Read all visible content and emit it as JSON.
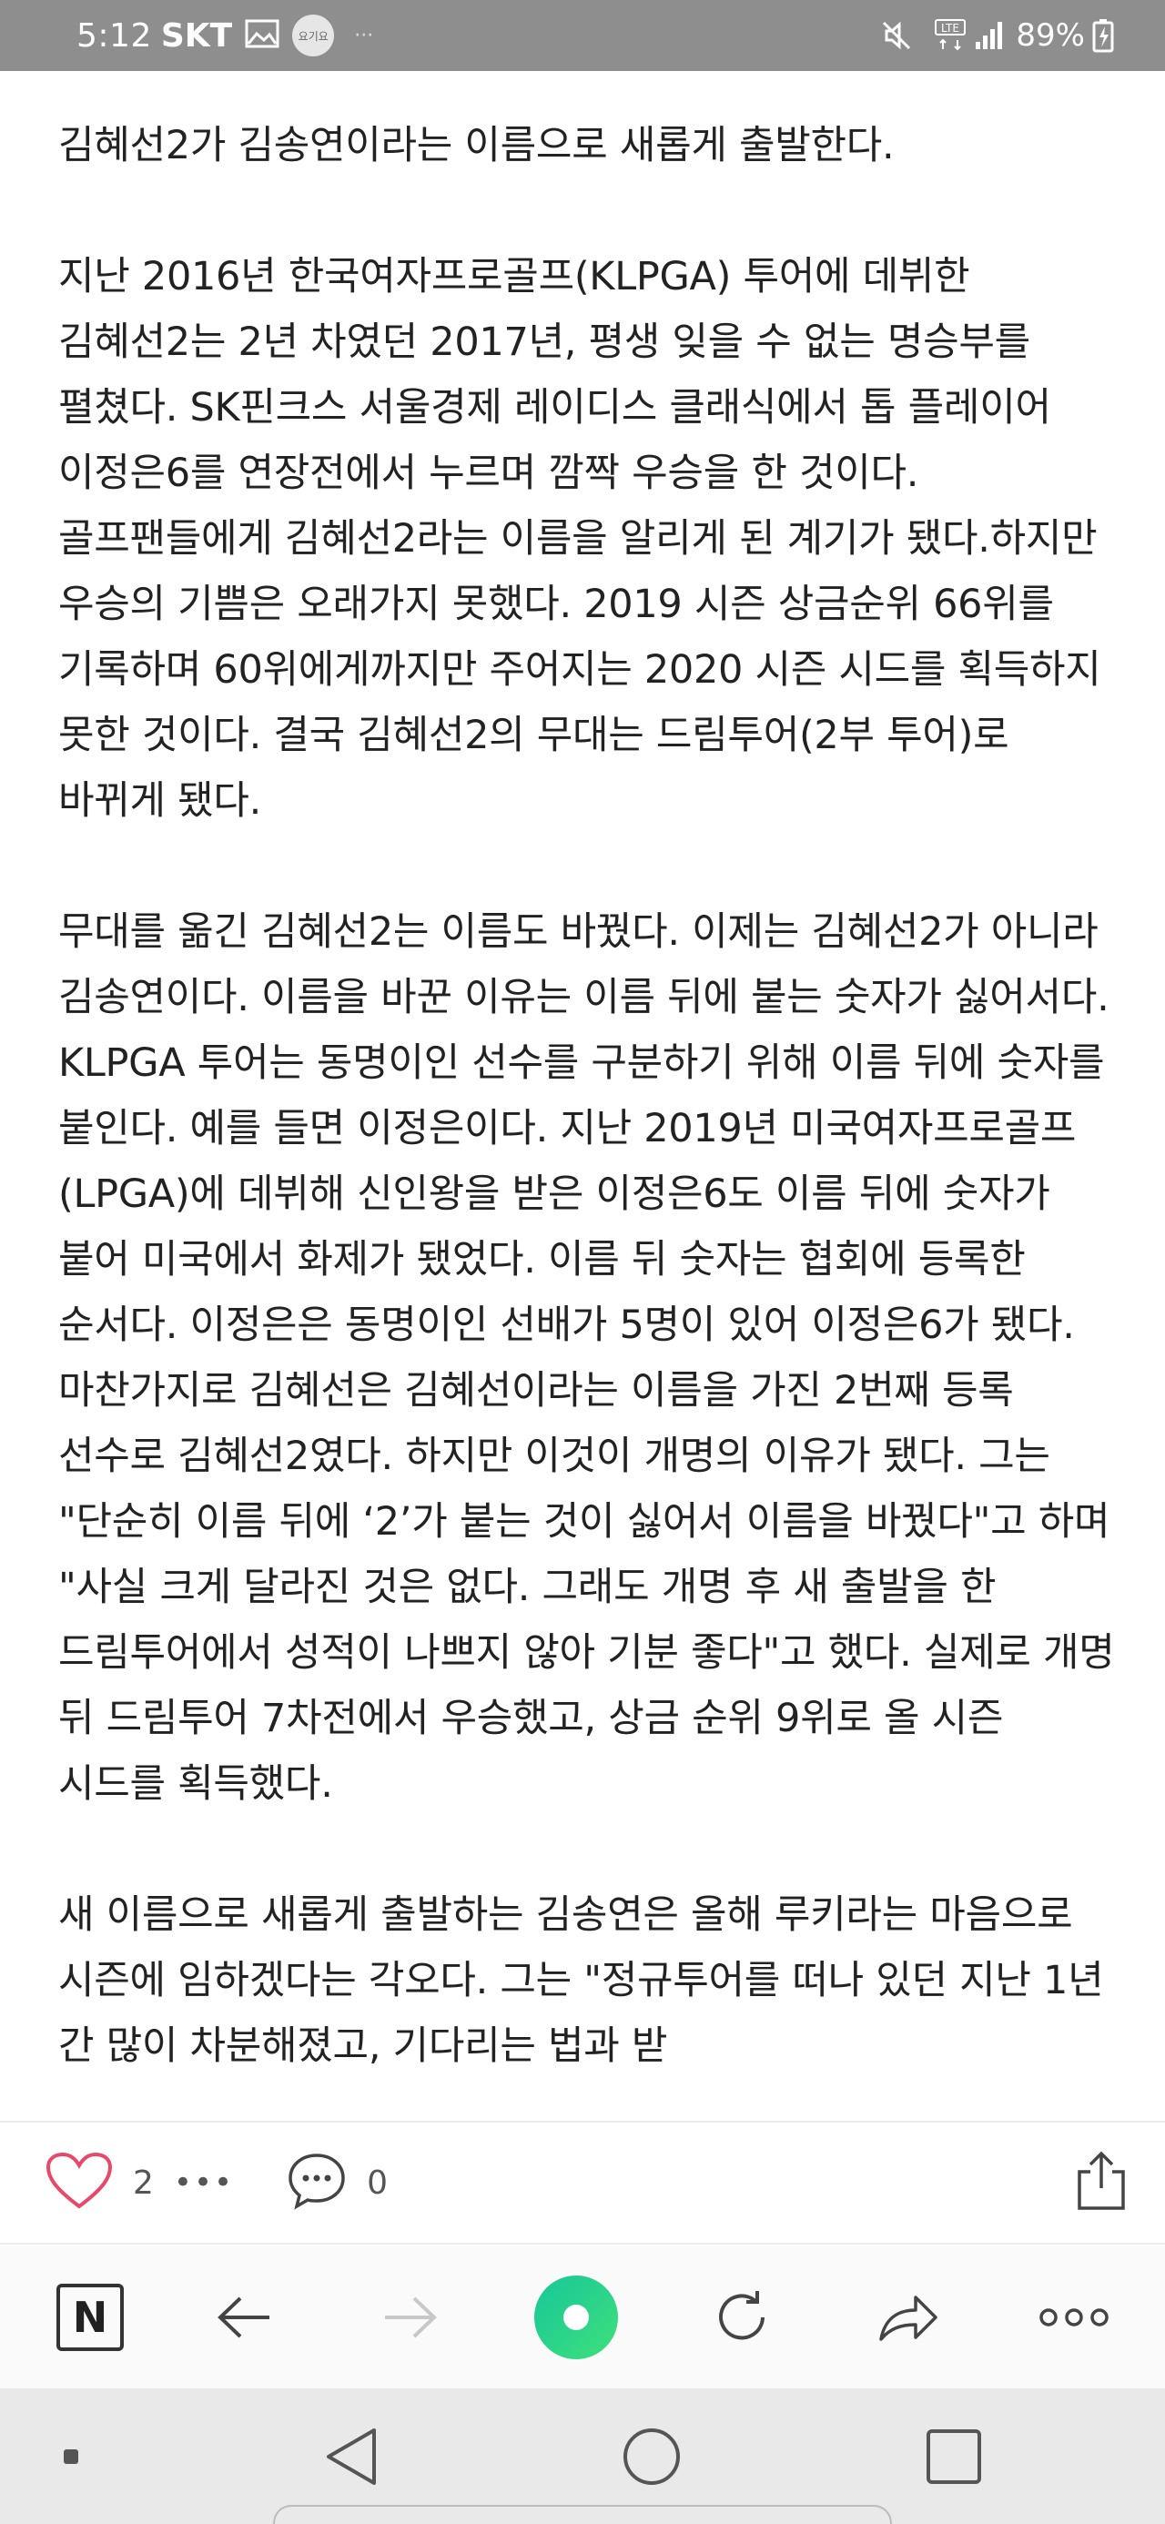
{
  "status_bar": {
    "time": "5:12",
    "carrier": "SKT",
    "badge": "요기요",
    "dots": "···",
    "network": "LTE",
    "battery": "89%"
  },
  "article": {
    "paragraphs": [
      "김혜선2가 김송연이라는 이름으로 새롭게 출발한다.",
      "지난 2016년 한국여자프로골프(KLPGA) 투어에 데뷔한 김혜선2는 2년 차였던 2017년, 평생 잊을 수 없는 명승부를 펼쳤다. SK핀크스 서울경제 레이디스 클래식에서 톱 플레이어 이정은6를 연장전에서 누르며 깜짝 우승을 한 것이다. 골프팬들에게 김혜선2라는 이름을 알리게 된 계기가 됐다.하지만 우승의 기쁨은 오래가지 못했다. 2019 시즌 상금순위 66위를 기록하며 60위에게까지만 주어지는 2020 시즌 시드를 획득하지 못한 것이다. 결국 김혜선2의 무대는 드림투어(2부 투어)로 바뀌게 됐다.",
      "무대를 옮긴 김혜선2는 이름도 바꿨다. 이제는 김혜선2가 아니라 김송연이다. 이름을 바꾼 이유는 이름 뒤에 붙는 숫자가 싫어서다. KLPGA 투어는 동명이인 선수를 구분하기 위해 이름 뒤에 숫자를 붙인다. 예를 들면 이정은이다. 지난 2019년 미국여자프로골프(LPGA)에 데뷔해 신인왕을 받은 이정은6도 이름 뒤에 숫자가 붙어 미국에서 화제가 됐었다. 이름 뒤 숫자는 협회에 등록한 순서다. 이정은은 동명이인 선배가 5명이 있어 이정은6가 됐다. 마찬가지로 김혜선은 김혜선이라는 이름을 가진 2번째 등록 선수로 김혜선2였다. 하지만 이것이 개명의 이유가 됐다. 그는 \"단순히 이름 뒤에 ‘2’가 붙는 것이 싫어서 이름을 바꿨다\"고 하며 \"사실 크게 달라진 것은 없다. 그래도 개명 후 새 출발을 한 드림투어에서 성적이 나쁘지 않아 기분 좋다\"고 했다. 실제로 개명 뒤 드림투어 7차전에서 우승했고, 상금 순위 9위로 올 시즌 시드를 획득했다.",
      "새 이름으로 새롭게 출발하는 김송연은 올해 루키라는 마음으로 시즌에 임하겠다는 각오다. 그는 \"정규투어를 떠나 있던 지난 1년 간 많이 차분해졌고, 기다리는 법과 받"
    ]
  },
  "reactions": {
    "like_count": "2",
    "more": "•••",
    "comment_count": "0"
  },
  "browser_nav": {
    "n_label": "N"
  },
  "colors": {
    "status_bar_bg": "#8e8e8e",
    "heart": "#e8486a",
    "green_button": "#1fd28a"
  }
}
